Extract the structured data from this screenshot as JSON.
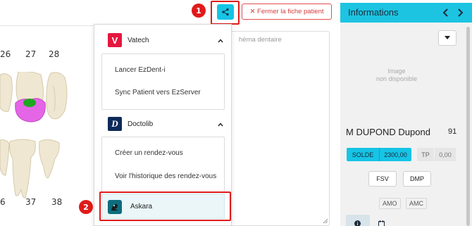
{
  "chart": {
    "upper_numbers": [
      "26",
      "27",
      "28"
    ],
    "lower_numbers": [
      "6",
      "37",
      "38"
    ]
  },
  "toolbar": {
    "share_icon": "share-icon",
    "close_patient_label": "✕ Fermer la fiche patient",
    "badge_share": "1",
    "badge_askara": "2"
  },
  "schema": {
    "placeholder": "héma dentaire"
  },
  "menu": {
    "vatech": {
      "brand": "Vatech",
      "logo_letter": "V",
      "logo_color": "#e5173f",
      "items": [
        "Lancer EzDent-i",
        "Sync Patient vers EzServer"
      ]
    },
    "doctolib": {
      "brand": "Doctolib",
      "logo_letter": "D",
      "logo_color": "#0d2b5a",
      "items": [
        "Créer un rendez-vous",
        "Voir l'historique des rendez-vous"
      ]
    },
    "askara": {
      "label": "Askara",
      "logo_color": "#0e6c7e"
    }
  },
  "info": {
    "title": "Informations",
    "no_image": "Image\nnon disponible",
    "patient_name": "M DUPOND Dupond",
    "patient_age": "91",
    "solde_label": "SOLDE",
    "solde_value": "2300,00",
    "tp_label": "TP",
    "tp_value": "0,00",
    "fsv_label": "FSV",
    "dmp_label": "DMP",
    "amo_label": "AMO",
    "amc_label": "AMC",
    "accent": "#1cc4e2"
  }
}
